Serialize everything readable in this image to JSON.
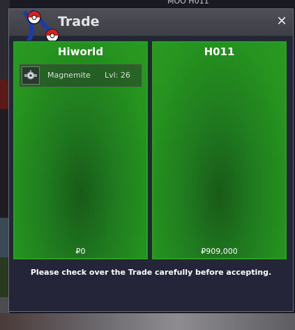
{
  "window": {
    "title": "Trade",
    "close_glyph": "✕"
  },
  "background": {
    "top_text": "MOO  H011"
  },
  "trade": {
    "left": {
      "player_name": "Hiworld",
      "items": [
        {
          "icon": "magnemite-icon",
          "name": "Magnemite",
          "level": "Lvl: 26"
        }
      ],
      "money": "₽0"
    },
    "right": {
      "player_name": "H011",
      "items": [],
      "money": "₽909,000"
    }
  },
  "notice": "Please check over the Trade carefully before accepting.",
  "colors": {
    "panel_green": "#26941f",
    "window_bg": "#25253a",
    "titlebar": "#4e4e56"
  }
}
